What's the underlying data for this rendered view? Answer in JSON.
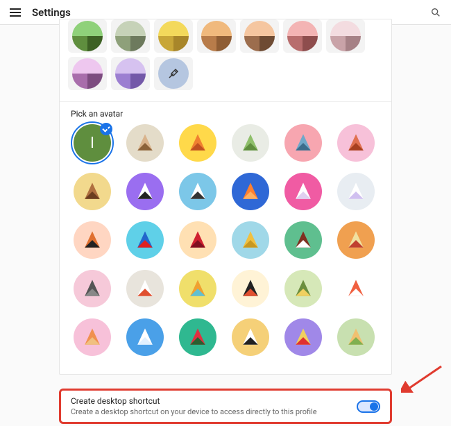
{
  "header": {
    "title": "Settings"
  },
  "colors": [
    {
      "top": "#8fd17a",
      "bl": "#5f8e3e",
      "br": "#3d6124"
    },
    {
      "top": "#c6d2b8",
      "bl": "#8ea07a",
      "br": "#6d7a5d"
    },
    {
      "top": "#f3d95b",
      "bl": "#c8a638",
      "br": "#a8862a"
    },
    {
      "top": "#f0b97d",
      "bl": "#b87c4a",
      "br": "#8f5d34"
    },
    {
      "top": "#f5c6a0",
      "bl": "#9c6d4d",
      "br": "#6e4b33"
    },
    {
      "top": "#f3b4b4",
      "bl": "#b86d6d",
      "br": "#8e4d4d"
    },
    {
      "top": "#f3dce0",
      "bl": "#c9a3a8",
      "br": "#a68186"
    },
    {
      "top": "#eec7ef",
      "bl": "#a86dab",
      "br": "#7d4c80"
    },
    {
      "top": "#d6c2f0",
      "bl": "#9c7fd1",
      "br": "#7358a8"
    }
  ],
  "avatarSection": {
    "label": "Pick an avatar",
    "selectedInitial": "I"
  },
  "avatars": [
    {
      "name": "initial",
      "bg": "#5f8e3e"
    },
    {
      "name": "cat",
      "bg": "#e4dcc9"
    },
    {
      "name": "fox",
      "bg": "#ffd94a"
    },
    {
      "name": "frog",
      "bg": "#e9ece5"
    },
    {
      "name": "elephant",
      "bg": "#f7a6b0"
    },
    {
      "name": "owl",
      "bg": "#f7c1d9"
    },
    {
      "name": "monkey",
      "bg": "#f2d98d"
    },
    {
      "name": "panda",
      "bg": "#9a6ef0"
    },
    {
      "name": "penguin",
      "bg": "#7cc7e8"
    },
    {
      "name": "butterfly",
      "bg": "#2f68d6"
    },
    {
      "name": "rabbit",
      "bg": "#f05ba3"
    },
    {
      "name": "unicorn",
      "bg": "#e8edf2"
    },
    {
      "name": "basketball",
      "bg": "#ffd6c2"
    },
    {
      "name": "bicycle",
      "bg": "#5fd0e8"
    },
    {
      "name": "bird",
      "bg": "#ffe0b3"
    },
    {
      "name": "cheese",
      "bg": "#a0d8e8"
    },
    {
      "name": "football",
      "bg": "#5fbf8f"
    },
    {
      "name": "ramen",
      "bg": "#f0a050"
    },
    {
      "name": "sunglasses",
      "bg": "#f6c9d9"
    },
    {
      "name": "sushi",
      "bg": "#e8e4dc"
    },
    {
      "name": "tamagotchi",
      "bg": "#f0df6b"
    },
    {
      "name": "vinyl",
      "bg": "#fff3d6"
    },
    {
      "name": "avocado",
      "bg": "#d6e8b8"
    },
    {
      "name": "smile",
      "bg": "#ffffff"
    },
    {
      "name": "icecream",
      "bg": "#f7c1d9"
    },
    {
      "name": "note",
      "bg": "#4aa0e8"
    },
    {
      "name": "watermelon",
      "bg": "#2fb890"
    },
    {
      "name": "onigiri",
      "bg": "#f5d078"
    },
    {
      "name": "popcorn",
      "bg": "#a088e8"
    },
    {
      "name": "sandwich",
      "bg": "#c8e0b0"
    }
  ],
  "shortcut": {
    "title": "Create desktop shortcut",
    "subtitle": "Create a desktop shortcut on your device to access directly to this profile",
    "enabled": true
  }
}
